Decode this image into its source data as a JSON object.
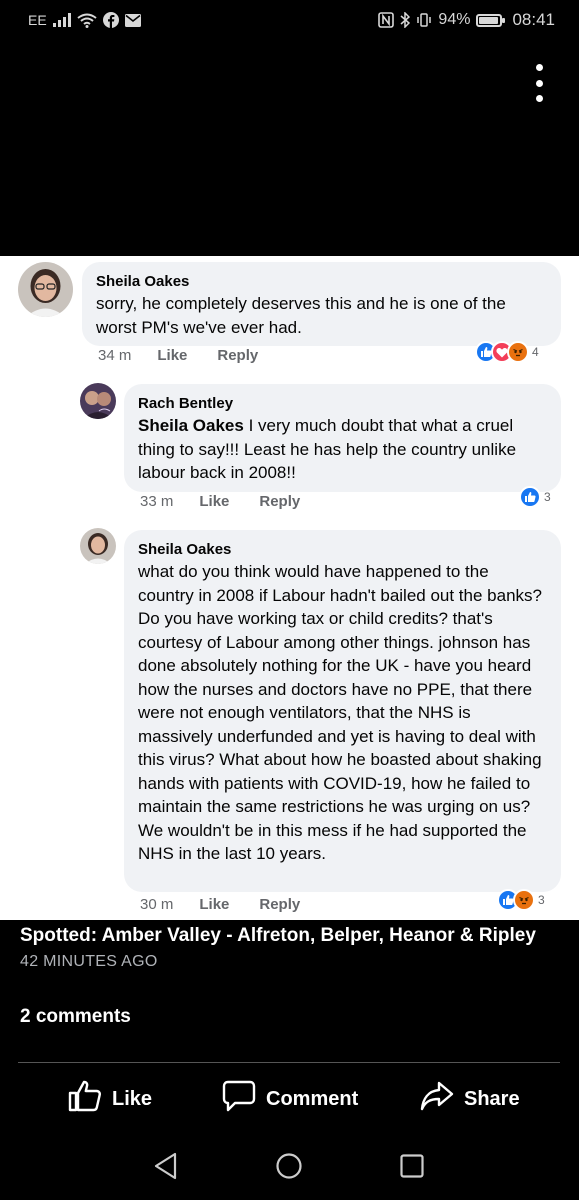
{
  "status_bar": {
    "carrier": "EE",
    "battery": "94%",
    "battery_level": 0.94,
    "time": "08:41"
  },
  "comments": [
    {
      "author": "Sheila Oakes",
      "mention": "",
      "text": "sorry, he completely deserves this and he is one of the worst PM's we've ever had.",
      "time": "34 m",
      "like_label": "Like",
      "reply_label": "Reply",
      "reaction_icons": [
        "like-icon",
        "love-icon",
        "angry-icon"
      ],
      "reaction_count": "4"
    },
    {
      "author": "Rach Bentley",
      "mention": "Sheila Oakes",
      "text": " I very much doubt that what a cruel thing to say!!! Least he has help the country unlike labour back in 2008!!",
      "time": "33 m",
      "like_label": "Like",
      "reply_label": "Reply",
      "reaction_icons": [
        "like-icon"
      ],
      "reaction_count": "3"
    },
    {
      "author": "Sheila Oakes",
      "mention": "",
      "text": "what do you think would have happened to the country in 2008 if Labour hadn't bailed out the banks?  Do you have working tax or child credits? that's courtesy of Labour among other things. johnson has done absolutely nothing for the UK - have you heard how the nurses and doctors have no PPE, that there were not enough ventilators, that the NHS is massively underfunded and yet is having to deal with this virus?  What about how he boasted about shaking hands with patients with COVID-19, how he failed to maintain the same restrictions he was urging on us?  We wouldn't be in this mess if he had supported the NHS in the last 10 years.",
      "time": "30 m",
      "like_label": "Like",
      "reply_label": "Reply",
      "reaction_icons": [
        "like-icon",
        "angry-icon"
      ],
      "reaction_count": "3"
    }
  ],
  "post": {
    "title": "Spotted: Amber Valley - Alfreton, Belper, Heanor & Ripley",
    "time": "42 MINUTES AGO",
    "comments_count": "2 comments"
  },
  "actions": {
    "like": "Like",
    "comment": "Comment",
    "share": "Share"
  },
  "colors": {
    "like_blue": "#1877f2",
    "love_red": "#f33e58",
    "angry_orange": "#e9710f",
    "bubble_gray": "#f0f2f5"
  }
}
